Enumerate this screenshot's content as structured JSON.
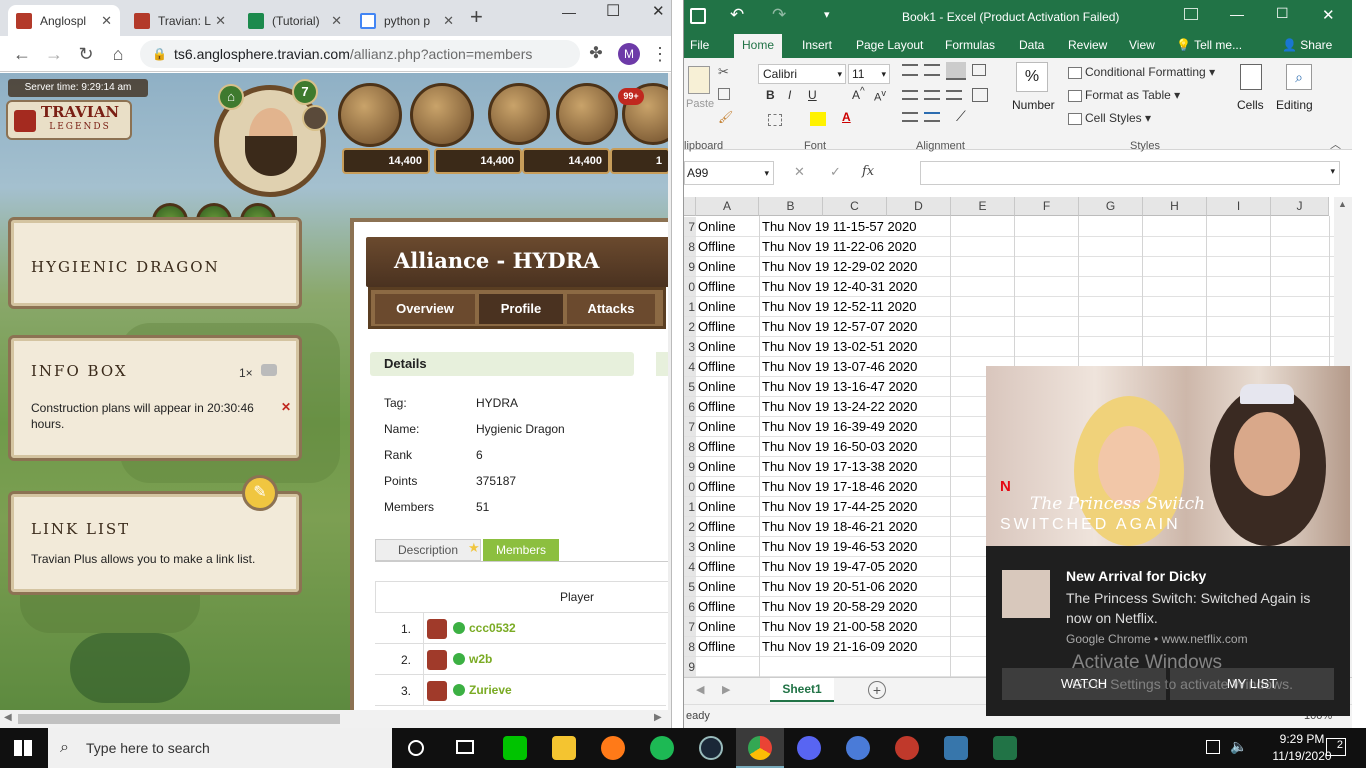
{
  "chrome": {
    "tabs": [
      {
        "label": "Anglospl",
        "active": true
      },
      {
        "label": "Travian: L"
      },
      {
        "label": "(Tutorial)"
      },
      {
        "label": "python p"
      }
    ],
    "new_tab": "+",
    "url_domain": "ts6.anglosphere.travian.com",
    "url_path": "/allianz.php?action=members",
    "profile_initial": "M",
    "window_controls": {
      "minimize": "—",
      "maximize": "☐",
      "close": "✕"
    }
  },
  "travian": {
    "server_time": "Server time: 9:29:14 am",
    "logo_line1": "TRAVIAN",
    "logo_line2": "LEGENDS",
    "level_badge": "7",
    "notif_badge": "99+",
    "resources": [
      "14,400",
      "14,400",
      "14,400",
      "1"
    ],
    "alliance_box_title": "HYGIENIC DRAGON",
    "info_box": {
      "title": "INFO BOX",
      "count": "1×",
      "message": "Construction plans will appear in 20:30:46 hours.",
      "close": "✕"
    },
    "link_list": {
      "title": "LINK LIST",
      "message": "Travian Plus allows you to make a link list."
    },
    "alliance_title": "Alliance - HYDRA",
    "alliance_tabs": [
      "Overview",
      "Profile",
      "Attacks"
    ],
    "details_header": "Details",
    "details": [
      {
        "label": "Tag:",
        "value": "HYDRA"
      },
      {
        "label": "Name:",
        "value": "Hygienic Dragon"
      },
      {
        "label": "Rank",
        "value": "6"
      },
      {
        "label": "Points",
        "value": "375187"
      },
      {
        "label": "Members",
        "value": "51"
      }
    ],
    "sub_tabs": [
      "Description",
      "Members"
    ],
    "members_header": "Player",
    "members": [
      {
        "rank": "1.",
        "name": "ccc0532"
      },
      {
        "rank": "2.",
        "name": "w2b"
      },
      {
        "rank": "3.",
        "name": "Zurieve"
      }
    ]
  },
  "excel": {
    "title": "Book1 - Excel (Product Activation Failed)",
    "ribbon_tabs": [
      "File",
      "Home",
      "Insert",
      "Page Layout",
      "Formulas",
      "Data",
      "Review",
      "View"
    ],
    "tell_me": "Tell me...",
    "share": "Share",
    "font_name": "Calibri",
    "font_size": "11",
    "groups": [
      "lipboard",
      "Font",
      "Alignment",
      "Styles"
    ],
    "paste": "Paste",
    "number": "Number",
    "cells": "Cells",
    "editing": "Editing",
    "styles_items": [
      "Conditional Formatting",
      "Format as Table",
      "Cell Styles"
    ],
    "name_box": "A99",
    "fx": "fx",
    "columns": [
      "A",
      "B",
      "C",
      "D",
      "E",
      "F",
      "G",
      "H",
      "I",
      "J"
    ],
    "rows": [
      {
        "num": "7",
        "status": "Online",
        "time": "Thu Nov 19 11-15-57 2020"
      },
      {
        "num": "8",
        "status": "Offline",
        "time": "Thu Nov 19 11-22-06 2020"
      },
      {
        "num": "9",
        "status": "Online",
        "time": "Thu Nov 19 12-29-02 2020"
      },
      {
        "num": "0",
        "status": "Offline",
        "time": "Thu Nov 19 12-40-31 2020"
      },
      {
        "num": "1",
        "status": "Online",
        "time": "Thu Nov 19 12-52-11 2020"
      },
      {
        "num": "2",
        "status": "Offline",
        "time": "Thu Nov 19 12-57-07 2020"
      },
      {
        "num": "3",
        "status": "Online",
        "time": "Thu Nov 19 13-02-51 2020"
      },
      {
        "num": "4",
        "status": "Offline",
        "time": "Thu Nov 19 13-07-46 2020"
      },
      {
        "num": "5",
        "status": "Online",
        "time": "Thu Nov 19 13-16-47 2020"
      },
      {
        "num": "6",
        "status": "Offline",
        "time": "Thu Nov 19 13-24-22 2020"
      },
      {
        "num": "7",
        "status": "Online",
        "time": "Thu Nov 19 16-39-49 2020"
      },
      {
        "num": "8",
        "status": "Offline",
        "time": "Thu Nov 19 16-50-03 2020"
      },
      {
        "num": "9",
        "status": "Online",
        "time": "Thu Nov 19 17-13-38 2020"
      },
      {
        "num": "0",
        "status": "Offline",
        "time": "Thu Nov 19 17-18-46 2020"
      },
      {
        "num": "1",
        "status": "Online",
        "time": "Thu Nov 19 17-44-25 2020"
      },
      {
        "num": "2",
        "status": "Offline",
        "time": "Thu Nov 19 18-46-21 2020"
      },
      {
        "num": "3",
        "status": "Online",
        "time": "Thu Nov 19 19-46-53 2020"
      },
      {
        "num": "4",
        "status": "Offline",
        "time": "Thu Nov 19 19-47-05 2020"
      },
      {
        "num": "5",
        "status": "Online",
        "time": "Thu Nov 19 20-51-06 2020"
      },
      {
        "num": "6",
        "status": "Offline",
        "time": "Thu Nov 19 20-58-29 2020"
      },
      {
        "num": "7",
        "status": "Online",
        "time": "Thu Nov 19 21-00-58 2020"
      },
      {
        "num": "8",
        "status": "Offline",
        "time": "Thu Nov 19 21-16-09 2020"
      },
      {
        "num": "9",
        "status": "",
        "time": ""
      }
    ],
    "sheet_tab": "Sheet1",
    "status_text": "eady",
    "zoom": "100%"
  },
  "toast": {
    "poster_brand": "N",
    "poster_title1": "The Princess Switch",
    "poster_title2": "SWITCHED AGAIN",
    "title": "New Arrival for Dicky",
    "body": "The Princess Switch: Switched Again is now on Netflix.",
    "source": "Google Chrome • www.netflix.com",
    "watch": "WATCH",
    "my_list": "MY LIST",
    "activate_title": "Activate Windows",
    "activate_sub": "Go to Settings to activate Windows."
  },
  "taskbar": {
    "search_placeholder": "Type here to search",
    "time": "9:29 PM",
    "date": "11/19/2020",
    "notif_count": "2"
  }
}
